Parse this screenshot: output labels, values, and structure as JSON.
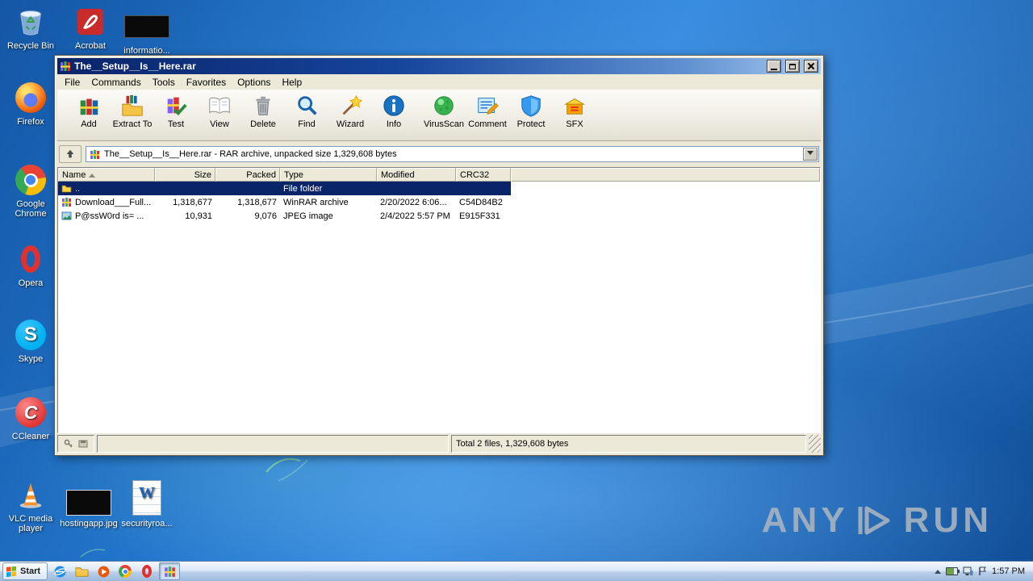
{
  "desktop": {
    "icons": [
      {
        "label": "Recycle Bin",
        "icon": "recycle-bin"
      },
      {
        "label": "Acrobat",
        "icon": "acrobat"
      },
      {
        "label": "informatio...",
        "icon": "redacted-black"
      },
      {
        "label": "Firefox",
        "icon": "firefox"
      },
      {
        "label": "Google Chrome",
        "icon": "chrome"
      },
      {
        "label": "Opera",
        "icon": "opera"
      },
      {
        "label": "Skype",
        "icon": "skype"
      },
      {
        "label": "CCleaner",
        "icon": "ccleaner"
      },
      {
        "label": "VLC media player",
        "icon": "vlc-cone"
      },
      {
        "label": "hostingapp.jpg",
        "icon": "image-thumbnail-black"
      },
      {
        "label": "securityroa...",
        "icon": "word-document"
      }
    ]
  },
  "watermark": {
    "left": "ANY",
    "right": "RUN",
    "logo": "anyrun-play-logo"
  },
  "winrar": {
    "title": "The__Setup__Is__Here.rar",
    "controls": [
      "minimize",
      "maximize",
      "close"
    ],
    "menus": [
      "File",
      "Commands",
      "Tools",
      "Favorites",
      "Options",
      "Help"
    ],
    "toolbar": [
      "Add",
      "Extract To",
      "Test",
      "View",
      "Delete",
      "Find",
      "Wizard",
      "Info",
      "VirusScan",
      "Comment",
      "Protect",
      "SFX"
    ],
    "address": "The__Setup__Is__Here.rar - RAR archive, unpacked size 1,329,608 bytes",
    "columns": [
      "Name",
      "Size",
      "Packed",
      "Type",
      "Modified",
      "CRC32"
    ],
    "rows": [
      {
        "name": "..",
        "size": "",
        "packed": "",
        "type": "File folder",
        "modified": "",
        "crc": "",
        "icon": "folder-up"
      },
      {
        "name": "Download___Full...",
        "size": "1,318,677",
        "packed": "1,318,677",
        "type": "WinRAR archive",
        "modified": "2/20/2022 6:06...",
        "crc": "C54D84B2",
        "icon": "winrar-archive"
      },
      {
        "name": "P@ssW0rd is=  ...",
        "size": "10,931",
        "packed": "9,076",
        "type": "JPEG image",
        "modified": "2/4/2022 5:57 PM",
        "crc": "E915F331",
        "icon": "jpeg-image"
      }
    ],
    "status_total": "Total 2 files, 1,329,608 bytes",
    "status_icons": [
      "key",
      "disk"
    ]
  },
  "taskbar": {
    "start_label": "Start",
    "clock": "1:57 PM",
    "quick_launch": [
      "internet-explorer",
      "explorer-folder",
      "media-app",
      "chrome",
      "opera",
      "winrar-active"
    ],
    "tray_icons": [
      "hidden-icons-chevron",
      "battery",
      "network",
      "notifications-flag"
    ]
  },
  "icon_glyphs": {
    "skype": "S",
    "ccleaner": "C",
    "word": "W"
  }
}
